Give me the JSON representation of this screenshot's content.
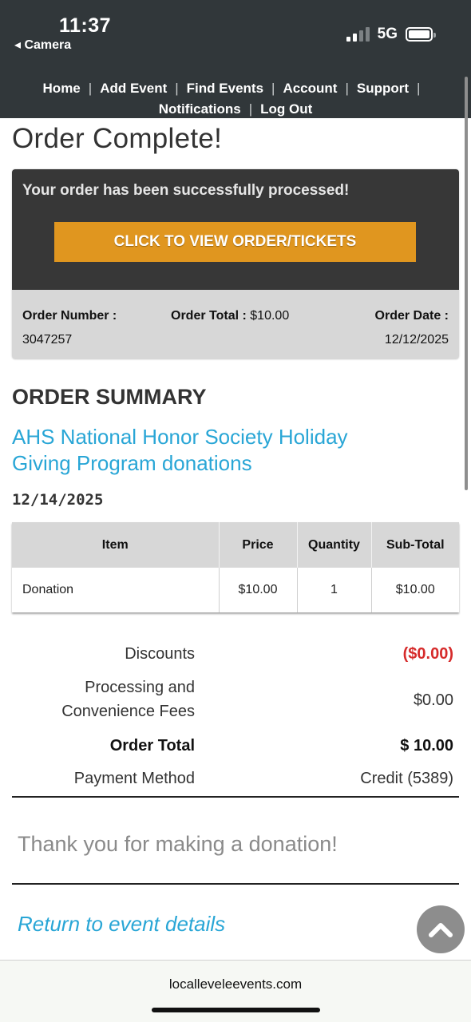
{
  "status_bar": {
    "time": "11:37",
    "back_label": "◂ Camera",
    "network": "5G",
    "signal_bars_active": 2,
    "signal_bars_total": 4
  },
  "nav": {
    "items": [
      "Home",
      "Add Event",
      "Find Events",
      "Account",
      "Support",
      "Notifications",
      "Log Out"
    ],
    "separator": "|"
  },
  "page": {
    "title": "Order Complete!"
  },
  "order": {
    "success_message": "Your order has been successfully processed!",
    "view_button_label": "CLICK TO VIEW ORDER/TICKETS",
    "number_label": "Order Number :",
    "number": "3047257",
    "total_label": "Order Total :",
    "total": "$10.00",
    "date_label": "Order Date :",
    "date": "12/12/2025"
  },
  "summary": {
    "heading": "ORDER SUMMARY",
    "event_title": "AHS National Honor Society Holiday Giving Program donations",
    "event_date": "12/14/2025",
    "columns": [
      "Item",
      "Price",
      "Quantity",
      "Sub-Total"
    ],
    "rows": [
      [
        "Donation",
        "$10.00",
        "1",
        "$10.00"
      ]
    ]
  },
  "totals": {
    "discounts_label": "Discounts",
    "discounts": "($0.00)",
    "fees_label_line1": "Processing and",
    "fees_label_line2": "Convenience Fees",
    "fees": "$0.00",
    "order_total_label": "Order Total",
    "order_total": "$ 10.00",
    "payment_label": "Payment Method",
    "payment": "Credit (5389)"
  },
  "thanks_message": "Thank you for making a donation!",
  "return_link": "Return to event details",
  "browser": {
    "url": "localleveleevents.com"
  },
  "colors": {
    "header_bg": "#31373a",
    "accent_button": "#e0961f",
    "link": "#29a6d6",
    "discount": "#d62b2b"
  },
  "icons": {
    "scroll_top": "chevron-up-icon",
    "battery": "battery-icon",
    "signal": "signal-icon"
  }
}
